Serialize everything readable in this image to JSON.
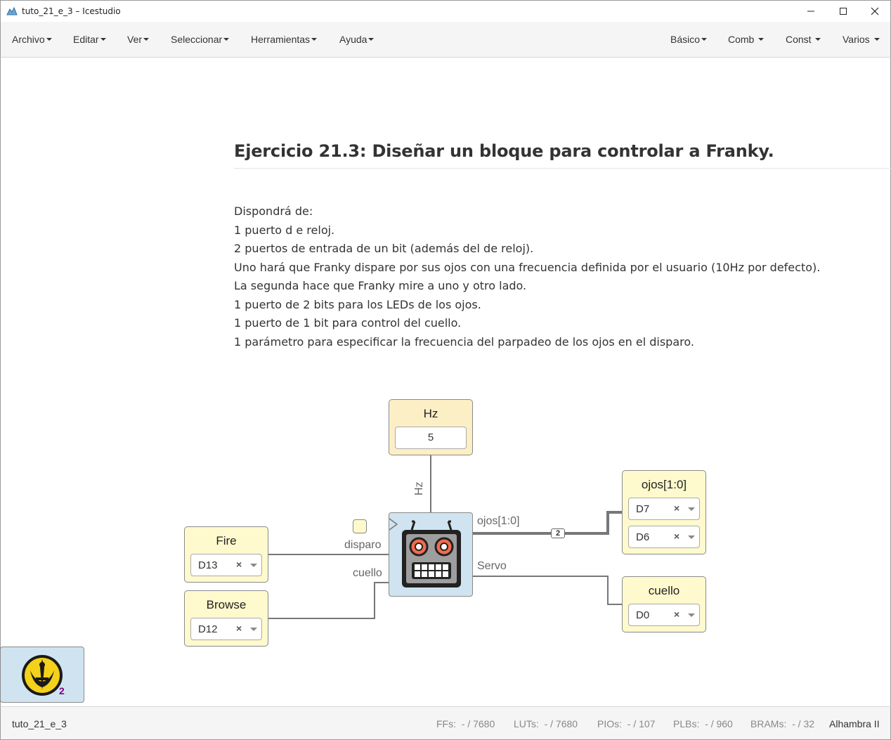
{
  "window": {
    "title": "tuto_21_e_3 – Icestudio"
  },
  "menu_left": [
    "Archivo",
    "Editar",
    "Ver",
    "Seleccionar",
    "Herramientas",
    "Ayuda"
  ],
  "menu_right": [
    "Básico",
    "Comb",
    "Const",
    "Varios"
  ],
  "doc": {
    "heading": "Ejercicio 21.3: Diseñar un bloque para controlar a Franky.",
    "lines": [
      "Dispondrá de:",
      "1 puerto d e reloj.",
      "2 puertos de entrada de un bit (además del de reloj).",
      "Uno hará que Franky dispare por sus ojos con una frecuencia definida por el usuario (10Hz por defecto).",
      "La segunda hace que Franky mire a uno y otro lado.",
      "1 puerto de 2 bits para los LEDs de los ojos.",
      "1 puerto de 1 bit para control del cuello.",
      "1 parámetro para especificar la frecuencia del parpadeo de los ojos en el disparo."
    ]
  },
  "circuit": {
    "param": {
      "name": "Hz",
      "value": "5"
    },
    "inputs": [
      {
        "name": "Fire",
        "pin": "D13"
      },
      {
        "name": "Browse",
        "pin": "D12"
      }
    ],
    "outputs": {
      "ojos": {
        "name": "ojos[1:0]",
        "pins": [
          "D7",
          "D6"
        ]
      },
      "cuello": {
        "name": "cuello",
        "pin": "D0"
      }
    },
    "labels": {
      "hz_port": "Hz",
      "disparo": "disparo",
      "cuello_in": "cuello",
      "ojos_out": "ojos[1:0]",
      "servo": "Servo",
      "bus_width": "2"
    },
    "clear_glyph": "×"
  },
  "board_widget": {
    "count": "2"
  },
  "footer": {
    "project": "tuto_21_e_3",
    "stats": [
      {
        "label": "FFs:",
        "value": "- / 7680"
      },
      {
        "label": "LUTs:",
        "value": "- / 7680"
      },
      {
        "label": "PIOs:",
        "value": "- / 107"
      },
      {
        "label": "PLBs:",
        "value": "- / 960"
      },
      {
        "label": "BRAMs:",
        "value": "- / 32"
      }
    ],
    "board": "Alhambra II"
  },
  "colors": {
    "param_block": "#fcefc6",
    "io_block": "#fffacd",
    "code_block": "#cfe4f0",
    "wire": "#777777",
    "board_badge": "#800080"
  },
  "icons": {
    "app": "icestudio-icon",
    "minimize": "minimize-icon",
    "maximize": "maximize-icon",
    "close": "close-icon",
    "franky": "robot-face-icon",
    "board": "jedi-order-icon"
  }
}
